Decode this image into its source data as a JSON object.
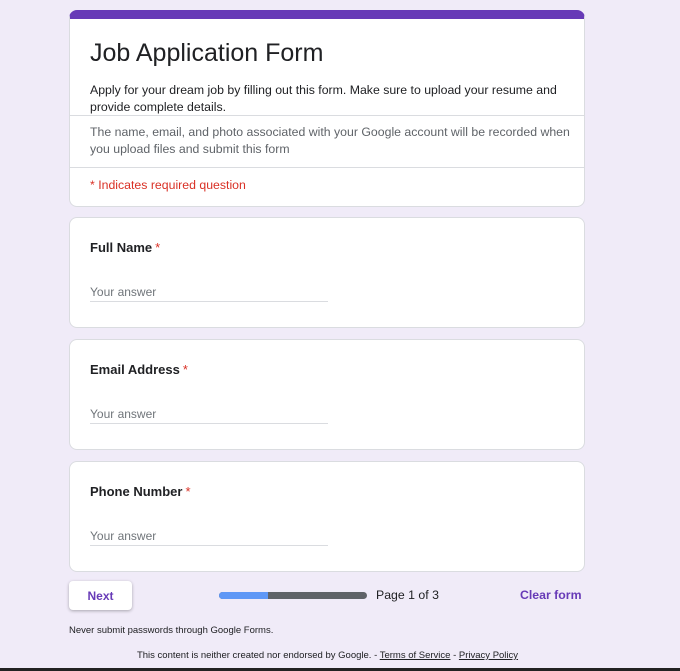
{
  "header": {
    "title": "Job Application Form",
    "description": "Apply for your dream job by filling out this form. Make sure to upload your resume and provide complete details.",
    "notice": "The name, email, and photo associated with your Google account will be recorded when you upload files and submit this form",
    "required_note": "* Indicates required question"
  },
  "questions": [
    {
      "label": "Full Name",
      "required": "*",
      "placeholder": "Your answer"
    },
    {
      "label": "Email Address",
      "required": "*",
      "placeholder": "Your answer"
    },
    {
      "label": "Phone Number",
      "required": "*",
      "placeholder": "Your answer"
    }
  ],
  "nav": {
    "next_label": "Next",
    "progress_percent": 33,
    "page_text": "Page 1 of 3",
    "clear_label": "Clear form"
  },
  "footer": {
    "warning": "Never submit passwords through Google Forms.",
    "disclaimer": "This content is neither created nor endorsed by Google. - ",
    "terms": "Terms of Service",
    "sep": " - ",
    "privacy": "Privacy Policy"
  },
  "colors": {
    "accent": "#673ab7",
    "progress": "#5e97f6",
    "required": "#d93025"
  }
}
